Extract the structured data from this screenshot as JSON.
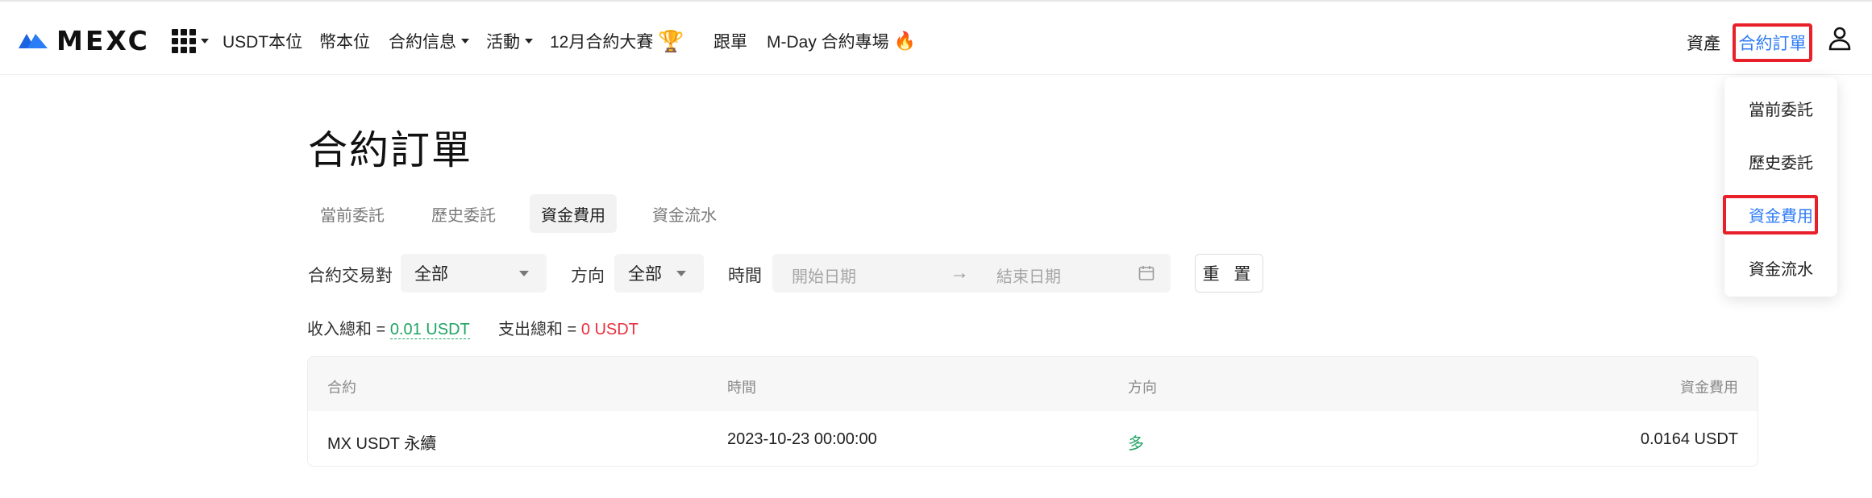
{
  "brand": {
    "name": "MEXC"
  },
  "nav": {
    "items": [
      {
        "label": "USDT本位"
      },
      {
        "label": "幣本位"
      },
      {
        "label": "合約信息"
      },
      {
        "label": "活動"
      },
      {
        "label": "12月合約大賽"
      },
      {
        "label": "跟單"
      },
      {
        "label": "M-Day 合約專場"
      }
    ],
    "assets": "資產",
    "orders": "合約訂單"
  },
  "icons": {
    "apps": "grid-icon",
    "trophy": "trophy-icon",
    "fire": "fire-icon",
    "user": "user-icon",
    "calendar": "calendar-icon",
    "arrow": "arrow-right-icon"
  },
  "dropdown": {
    "items": [
      {
        "label": "當前委託"
      },
      {
        "label": "歷史委託"
      },
      {
        "label": "資金費用"
      },
      {
        "label": "資金流水"
      }
    ]
  },
  "page": {
    "title": "合約訂單"
  },
  "tabs": [
    {
      "label": "當前委託"
    },
    {
      "label": "歷史委託"
    },
    {
      "label": "資金費用"
    },
    {
      "label": "資金流水"
    }
  ],
  "filters": {
    "pair_label": "合約交易對",
    "pair_value": "全部",
    "direction_label": "方向",
    "direction_value": "全部",
    "time_label": "時間",
    "start_placeholder": "開始日期",
    "end_placeholder": "結束日期",
    "reset": "重 置"
  },
  "summary": {
    "income_label": "收入總和 =",
    "income_value": "0.01 USDT",
    "expense_label": "支出總和 =",
    "expense_value": "0 USDT"
  },
  "table": {
    "headers": [
      "合約",
      "時間",
      "方向",
      "資金費用"
    ],
    "rows": [
      {
        "contract": "MX USDT 永續",
        "time": "2023-10-23 00:00:00",
        "direction": "多",
        "fee": "0.0164 USDT"
      }
    ]
  },
  "colors": {
    "accent": "#2e7bf6",
    "highlight": "#e8202a",
    "positive": "#20a464",
    "negative": "#e8303e"
  }
}
